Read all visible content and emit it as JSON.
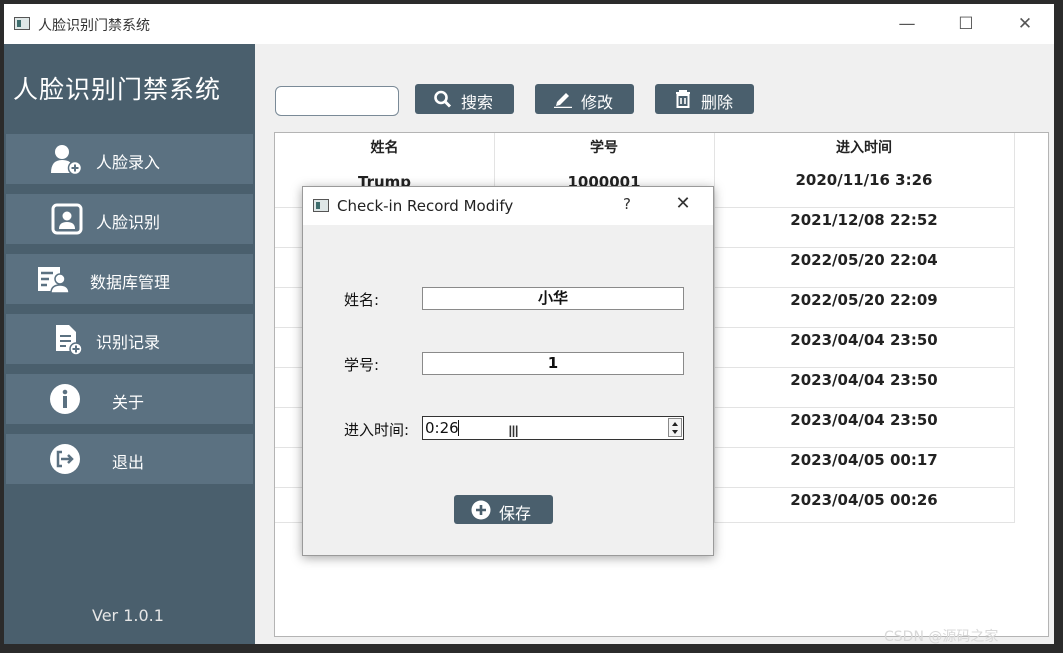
{
  "window": {
    "title": "人脸识别门禁系统"
  },
  "sidebar": {
    "title": "人脸识别门禁系统",
    "items": [
      {
        "label": "人脸录入",
        "icon": "user-add-icon"
      },
      {
        "label": "人脸识别",
        "icon": "face-scan-icon"
      },
      {
        "label": "数据库管理",
        "icon": "database-user-icon"
      },
      {
        "label": "识别记录",
        "icon": "record-add-icon"
      },
      {
        "label": "关于",
        "icon": "info-icon"
      },
      {
        "label": "退出",
        "icon": "logout-icon"
      }
    ],
    "version": "Ver 1.0.1"
  },
  "toolbar": {
    "search_value": "",
    "search_label": "搜索",
    "edit_label": "修改",
    "delete_label": "删除"
  },
  "table": {
    "columns": [
      "姓名",
      "学号",
      "进入时间"
    ],
    "first_row": {
      "name": "Trump",
      "id": "1000001"
    },
    "times": [
      "2020/11/16 3:26",
      "2021/12/08 22:52",
      "2022/05/20 22:04",
      "2022/05/20 22:09",
      "2023/04/04 23:50",
      "2023/04/04 23:50",
      "2023/04/04 23:50",
      "2023/04/05 00:17",
      "2023/04/05 00:26"
    ]
  },
  "dialog": {
    "title": "Check-in Record Modify",
    "help": "?",
    "name_label": "姓名:",
    "name_value": "小华",
    "id_label": "学号:",
    "id_value": "1",
    "time_label": "进入时间:",
    "time_value": "0:26",
    "save_label": "保存"
  },
  "watermark": "CSDN @源码之家",
  "colors": {
    "sidebar": "#4a5f6d",
    "nav_item": "#5b7181",
    "button": "#4a5f6d"
  }
}
